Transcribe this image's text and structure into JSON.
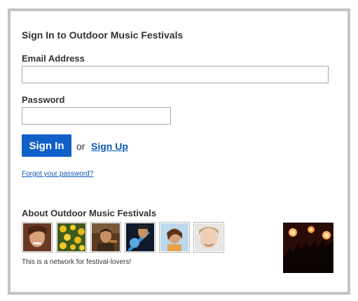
{
  "signin": {
    "title": "Sign In to Outdoor Music Festivals",
    "email_label": "Email Address",
    "email_value": "",
    "password_label": "Password",
    "password_value": "",
    "signin_button": "Sign In",
    "or_text": "or",
    "signup_link": "Sign Up",
    "forgot_link": "Forgot your password?"
  },
  "about": {
    "title": "About Outdoor Music Festivals",
    "tagline": "This is a network for festival-lovers!",
    "members": [
      {
        "icon": "member-photo-icon"
      },
      {
        "icon": "member-photo-icon"
      },
      {
        "icon": "member-photo-icon"
      },
      {
        "icon": "member-photo-icon"
      },
      {
        "icon": "member-photo-icon"
      },
      {
        "icon": "member-photo-icon"
      }
    ],
    "hero_icon": "concert-crowd-image"
  },
  "colors": {
    "accent": "#1060c8",
    "link": "#0a58b5",
    "border": "#c4c4c4"
  }
}
